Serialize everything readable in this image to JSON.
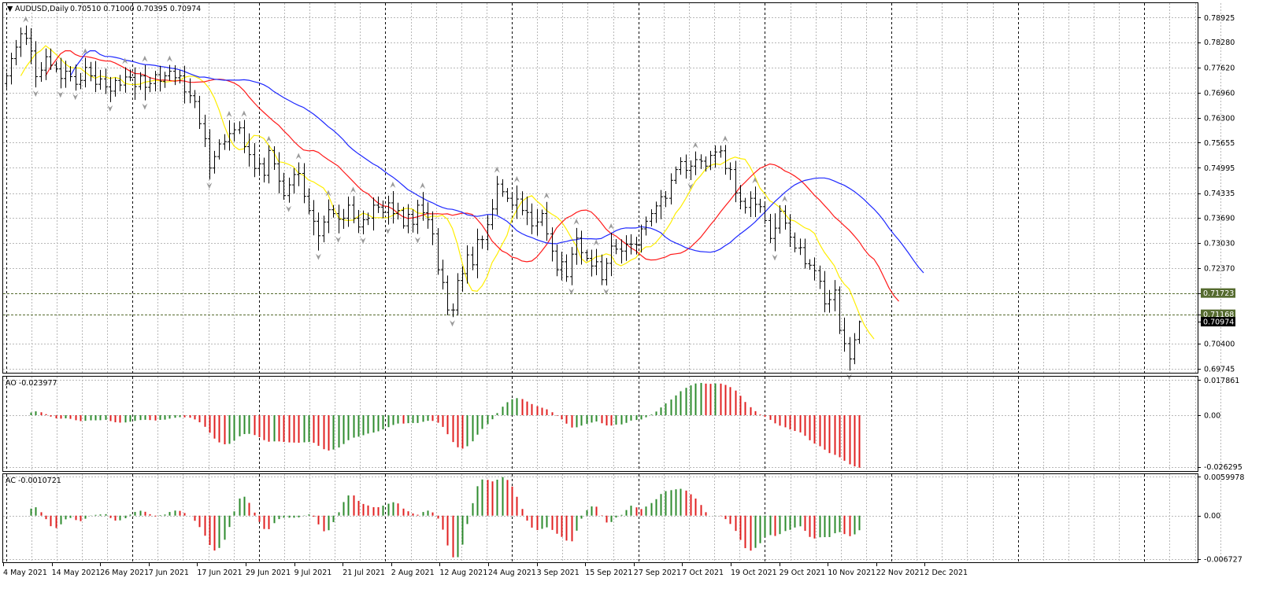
{
  "header": {
    "symbol_label": "AUDUSD,Daily",
    "ohlc_label": "0.70510 0.71000 0.70395 0.70974"
  },
  "colors": {
    "bull": "#2e8b2e",
    "bear": "#e02020",
    "ma_fast": "#ffee00",
    "ma_mid": "#ff1a1a",
    "ma_slow": "#1e28ff",
    "tag_green": "#556b2f",
    "tag_black": "#000000"
  },
  "chart_data": [
    {
      "type": "ohlc",
      "name": "price",
      "title": "AUDUSD,Daily",
      "ylim": [
        0.6966,
        0.7928
      ],
      "y_ticks": [
        "0.78925",
        "0.78280",
        "0.77620",
        "0.76960",
        "0.76300",
        "0.75655",
        "0.74995",
        "0.74335",
        "0.73690",
        "0.73030",
        "0.72370",
        "0.71723",
        "0.71168",
        "0.70974",
        "0.70400",
        "0.69745"
      ],
      "price_tags": [
        {
          "label": "0.71723",
          "value": 0.71723,
          "style": "green"
        },
        {
          "label": "0.71168",
          "value": 0.71168,
          "style": "green"
        },
        {
          "label": "0.70974",
          "value": 0.70974,
          "style": "black"
        }
      ],
      "close": [
        0.774,
        0.7785,
        0.7815,
        0.785,
        0.7838,
        0.7805,
        0.7738,
        0.7755,
        0.779,
        0.7768,
        0.7758,
        0.7733,
        0.7752,
        0.7738,
        0.7718,
        0.7728,
        0.7762,
        0.774,
        0.7718,
        0.7732,
        0.7711,
        0.77,
        0.7728,
        0.7716,
        0.7737,
        0.7736,
        0.7712,
        0.774,
        0.771,
        0.772,
        0.7743,
        0.7726,
        0.774,
        0.7752,
        0.7735,
        0.774,
        0.7698,
        0.7688,
        0.7673,
        0.7615,
        0.7576,
        0.7499,
        0.7529,
        0.7562,
        0.7568,
        0.7589,
        0.7599,
        0.7604,
        0.7555,
        0.7534,
        0.7498,
        0.751,
        0.748,
        0.7545,
        0.751,
        0.7465,
        0.7427,
        0.7455,
        0.7482,
        0.7485,
        0.7425,
        0.7388,
        0.736,
        0.7322,
        0.7358,
        0.739,
        0.738,
        0.7365,
        0.7368,
        0.7402,
        0.7368,
        0.7345,
        0.7364,
        0.7368,
        0.7402,
        0.7397,
        0.7383,
        0.7408,
        0.738,
        0.7388,
        0.7348,
        0.7378,
        0.7352,
        0.7402,
        0.7382,
        0.7364,
        0.7327,
        0.7233,
        0.72,
        0.7128,
        0.7128,
        0.7205,
        0.7223,
        0.7272,
        0.7246,
        0.7312,
        0.7312,
        0.7351,
        0.7392,
        0.7457,
        0.7437,
        0.742,
        0.7402,
        0.7418,
        0.7388,
        0.7383,
        0.7348,
        0.7358,
        0.738,
        0.7327,
        0.7282,
        0.7233,
        0.7254,
        0.7215,
        0.7274,
        0.7316,
        0.7278,
        0.7263,
        0.7243,
        0.7254,
        0.7207,
        0.725,
        0.7295,
        0.7287,
        0.7282,
        0.73,
        0.73,
        0.7298,
        0.734,
        0.736,
        0.738,
        0.74,
        0.7424,
        0.742,
        0.7467,
        0.7495,
        0.7516,
        0.7493,
        0.7504,
        0.7521,
        0.7517,
        0.7504,
        0.7532,
        0.7541,
        0.7544,
        0.7498,
        0.7495,
        0.7434,
        0.7412,
        0.7396,
        0.742,
        0.7404,
        0.7398,
        0.7362,
        0.7315,
        0.7342,
        0.7386,
        0.7355,
        0.7318,
        0.729,
        0.7291,
        0.7249,
        0.7245,
        0.7231,
        0.7203,
        0.7144,
        0.7155,
        0.718,
        0.7075,
        0.704,
        0.7,
        0.705,
        0.7097
      ],
      "ma": [
        {
          "color_key": "ma_fast",
          "period": 5
        },
        {
          "color_key": "ma_mid",
          "period": 13
        },
        {
          "color_key": "ma_slow",
          "period": 21
        }
      ]
    },
    {
      "type": "bar",
      "name": "AO",
      "title": "AO -0.023977",
      "ylim": [
        -0.028,
        0.0192
      ],
      "y_ticks": [
        "0.017861",
        "0.00",
        "-0.026295"
      ]
    },
    {
      "type": "bar",
      "name": "AC",
      "title": "AC -0.0010721",
      "ylim": [
        -0.0071,
        0.0063
      ],
      "y_ticks": [
        "0.0059978",
        "0.00",
        "-0.006727"
      ]
    }
  ],
  "x_axis": {
    "labels": [
      "4 May 2021",
      "14 May 2021",
      "26 May 2021",
      "7 Jun 2021",
      "17 Jun 2021",
      "29 Jun 2021",
      "9 Jul 2021",
      "21 Jul 2021",
      "2 Aug 2021",
      "12 Aug 2021",
      "24 Aug 2021",
      "3 Sep 2021",
      "15 Sep 2021",
      "27 Sep 2021",
      "7 Oct 2021",
      "19 Oct 2021",
      "29 Oct 2021",
      "10 Nov 2021",
      "22 Nov 2021",
      "2 Dec 2021"
    ]
  }
}
